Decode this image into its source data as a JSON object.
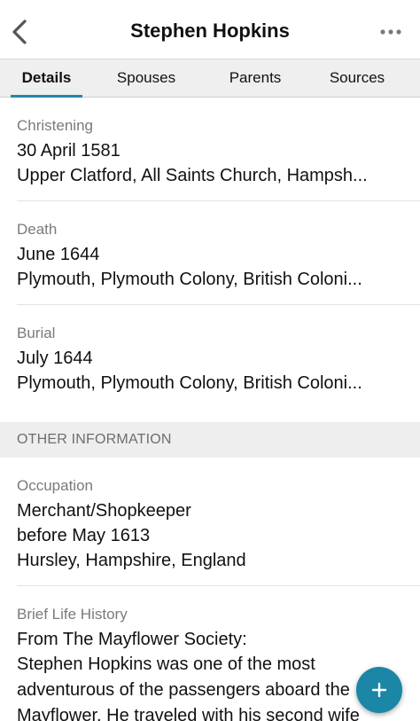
{
  "header": {
    "title": "Stephen Hopkins",
    "back_icon": "chevron-left-icon",
    "more_icon": "more-horizontal-icon"
  },
  "tabs": [
    {
      "label": "Details",
      "active": true
    },
    {
      "label": "Spouses",
      "active": false
    },
    {
      "label": "Parents",
      "active": false
    },
    {
      "label": "Sources",
      "active": false
    }
  ],
  "events": [
    {
      "label": "Christening",
      "date": "30 April 1581",
      "place": "Upper Clatford, All Saints Church, Hampsh..."
    },
    {
      "label": "Death",
      "date": "June 1644",
      "place": "Plymouth, Plymouth Colony, British Coloni..."
    },
    {
      "label": "Burial",
      "date": "July 1644",
      "place": "Plymouth, Plymouth Colony, British Coloni..."
    }
  ],
  "other_information": {
    "heading": "OTHER INFORMATION",
    "occupation": {
      "label": "Occupation",
      "value": "Merchant/Shopkeeper",
      "date": "before May 1613",
      "place": "Hursley, Hampshire, England"
    },
    "life_history": {
      "label": "Brief Life History",
      "line1": "From The Mayflower Society:",
      "line2": "Stephen Hopkins was one of the most adventurous of the passengers aboard the Mayflower. He traveled with his second wife"
    }
  },
  "fab": {
    "icon": "plus-icon",
    "symbol": "+"
  },
  "colors": {
    "accent": "#1f88a8",
    "fab": "#1b86a6",
    "muted": "#7a7a7a"
  }
}
